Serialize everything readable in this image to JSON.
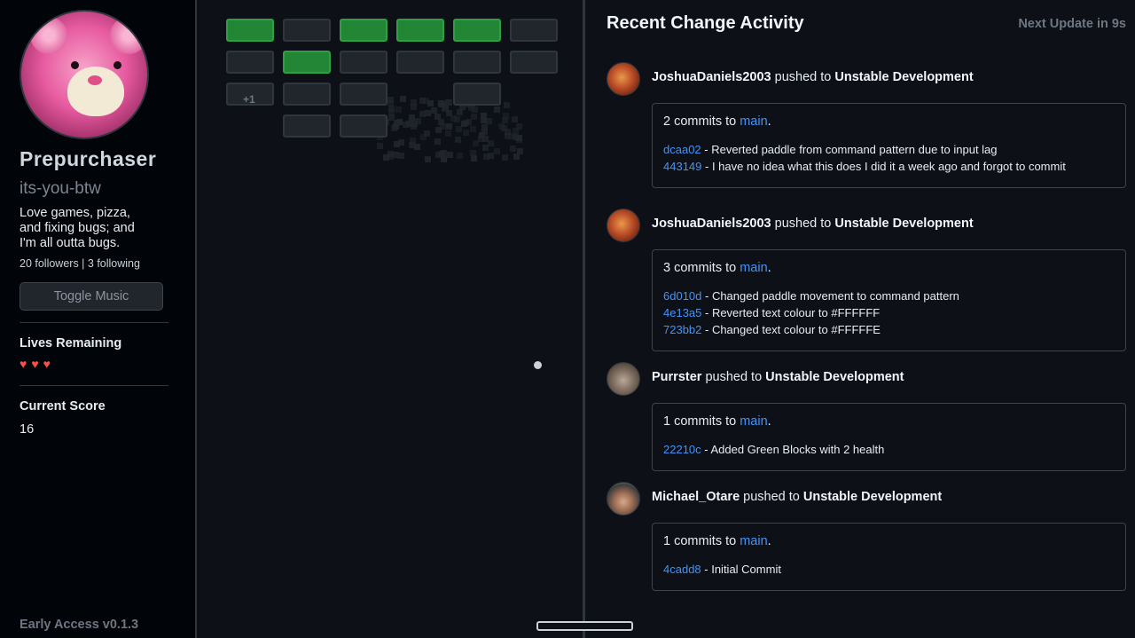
{
  "profile": {
    "display_name": "Prepurchaser",
    "login": "its-you-btw",
    "bio": "Love games, pizza, and fixing bugs; and I'm all outta bugs.",
    "follow_stats": "20 followers | 3 following",
    "music_button": "Toggle Music"
  },
  "status": {
    "lives_label": "Lives Remaining",
    "lives_remaining": 3,
    "score_label": "Current Score",
    "score": "16",
    "version": "Early Access v0.1.3"
  },
  "game": {
    "bricks": [
      {
        "row": 0,
        "col": 0,
        "type": "green"
      },
      {
        "row": 0,
        "col": 1,
        "type": "gray"
      },
      {
        "row": 0,
        "col": 2,
        "type": "green"
      },
      {
        "row": 0,
        "col": 3,
        "type": "green"
      },
      {
        "row": 0,
        "col": 4,
        "type": "green"
      },
      {
        "row": 0,
        "col": 5,
        "type": "gray"
      },
      {
        "row": 1,
        "col": 0,
        "type": "gray"
      },
      {
        "row": 1,
        "col": 1,
        "type": "green"
      },
      {
        "row": 1,
        "col": 2,
        "type": "gray"
      },
      {
        "row": 1,
        "col": 3,
        "type": "gray"
      },
      {
        "row": 1,
        "col": 4,
        "type": "gray"
      },
      {
        "row": 1,
        "col": 5,
        "type": "gray"
      },
      {
        "row": 2,
        "col": 0,
        "type": "gray"
      },
      {
        "row": 2,
        "col": 1,
        "type": "gray"
      },
      {
        "row": 2,
        "col": 2,
        "type": "gray"
      },
      {
        "row": 2,
        "col": 4,
        "type": "gray"
      },
      {
        "row": 3,
        "col": 1,
        "type": "gray"
      },
      {
        "row": 3,
        "col": 2,
        "type": "gray"
      }
    ],
    "score_popup": "+1"
  },
  "feed": {
    "title": "Recent Change Activity",
    "next_update": "Next Update in 9s",
    "pushed_to_text": "pushed to",
    "events": [
      {
        "user": "JoshuaDaniels2003",
        "avatar": "pizza-avatar",
        "repo": "Unstable Development",
        "count_text": "2 commits to",
        "branch": "main",
        "commits": [
          {
            "sha": "dcaa02",
            "message": "- Reverted paddle from command pattern due to input lag"
          },
          {
            "sha": "443149",
            "message": "- I have no idea what this does I did it a week ago and forgot to commit"
          }
        ]
      },
      {
        "user": "JoshuaDaniels2003",
        "avatar": "pizza-avatar",
        "repo": "Unstable Development",
        "count_text": "3 commits to",
        "branch": "main",
        "commits": [
          {
            "sha": "6d010d",
            "message": "- Changed paddle movement to command pattern"
          },
          {
            "sha": "4e13a5",
            "message": "- Reverted text colour to #FFFFFF"
          },
          {
            "sha": "723bb2",
            "message": "- Changed text colour to #FFFFFE"
          }
        ]
      },
      {
        "user": "Purrster",
        "avatar": "cat-avatar",
        "repo": "Unstable Development",
        "count_text": "1 commits to",
        "branch": "main",
        "commits": [
          {
            "sha": "22210c",
            "message": "- Added Green Blocks with 2 health"
          }
        ]
      },
      {
        "user": "Michael_Otare",
        "avatar": "person-avatar",
        "repo": "Unstable Development",
        "count_text": "1 commits to",
        "branch": "main",
        "commits": [
          {
            "sha": "4cadd8",
            "message": "- Initial Commit"
          }
        ]
      }
    ]
  },
  "colors": {
    "background": "#0d1117",
    "sidebar": "#010409",
    "link": "#4493f8",
    "green_brick": "#238636",
    "heart": "#f85149"
  }
}
